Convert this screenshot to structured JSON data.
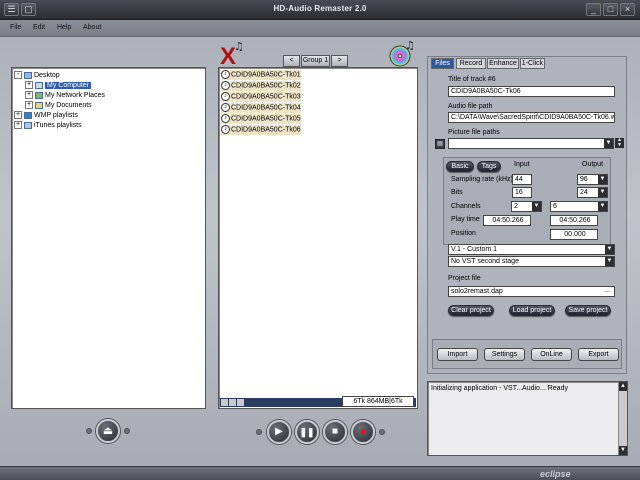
{
  "window": {
    "title": "HD-Audio Remaster 2.0"
  },
  "menu": [
    "File",
    "Edit",
    "Help",
    "About"
  ],
  "tree": {
    "items": [
      {
        "label": "Desktop",
        "expand": "-",
        "level": 0
      },
      {
        "label": "My Computer",
        "expand": "+",
        "level": 1,
        "selected": true
      },
      {
        "label": "My Network Places",
        "expand": "+",
        "level": 1
      },
      {
        "label": "My Documents",
        "expand": "+",
        "level": 1
      },
      {
        "label": "WMP playlists",
        "expand": "+",
        "level": 0
      },
      {
        "label": "iTunes playlists",
        "expand": "+",
        "level": 0
      }
    ]
  },
  "group": {
    "prev": "<",
    "label": "Group 1",
    "next": ">"
  },
  "files": [
    "CDID9A0BA50C-Tk01",
    "CDID9A0BA50C-Tk02",
    "CDID9A0BA50C-Tk03",
    "CDID9A0BA50C-Tk04",
    "CDID9A0BA50C-Tk05",
    "CDID9A0BA50C-Tk06"
  ],
  "status_box": "6Tk 864MB|6Tk",
  "tabs": [
    "Files",
    "Record",
    "Enhance",
    "1-Click"
  ],
  "props": {
    "title_label": "Title of track #6",
    "title_value": "CDID9A0BA50C-Tk06",
    "audio_label": "Audio file path",
    "audio_value": "C:\\DATA\\Wave\\SacredSpirit\\CDID9A0BA50C-Tk06.wav",
    "picture_label": "Picture file paths",
    "basic_btn": "Basic",
    "tags_btn": "Tags",
    "input_hdr": "Input",
    "output_hdr": "Output",
    "sr_label": "Sampling rate (kHz)",
    "sr_in": "44",
    "sr_out": "96",
    "bits_label": "Bits",
    "bits_in": "16",
    "bits_out": "24",
    "ch_label": "Channels",
    "ch_in": "2",
    "ch_out": "6",
    "play_label": "Play time",
    "play_in": "04:50.266",
    "play_out": "04:50.266",
    "pos_label": "Position",
    "pos_out": "00.000",
    "preset": "V.1 - Custom 1",
    "vst": "No VST second stage",
    "project_label": "Project file",
    "project_value": "solo2remast.dap",
    "browse": "...",
    "clear_btn": "Clear project",
    "load_btn": "Load project",
    "save_btn": "Save project"
  },
  "bottom_buttons": [
    "Import",
    "Settings",
    "OnLine",
    "Export"
  ],
  "log": "Initializing application - VST...Audio... Ready",
  "brand": "eclipse"
}
